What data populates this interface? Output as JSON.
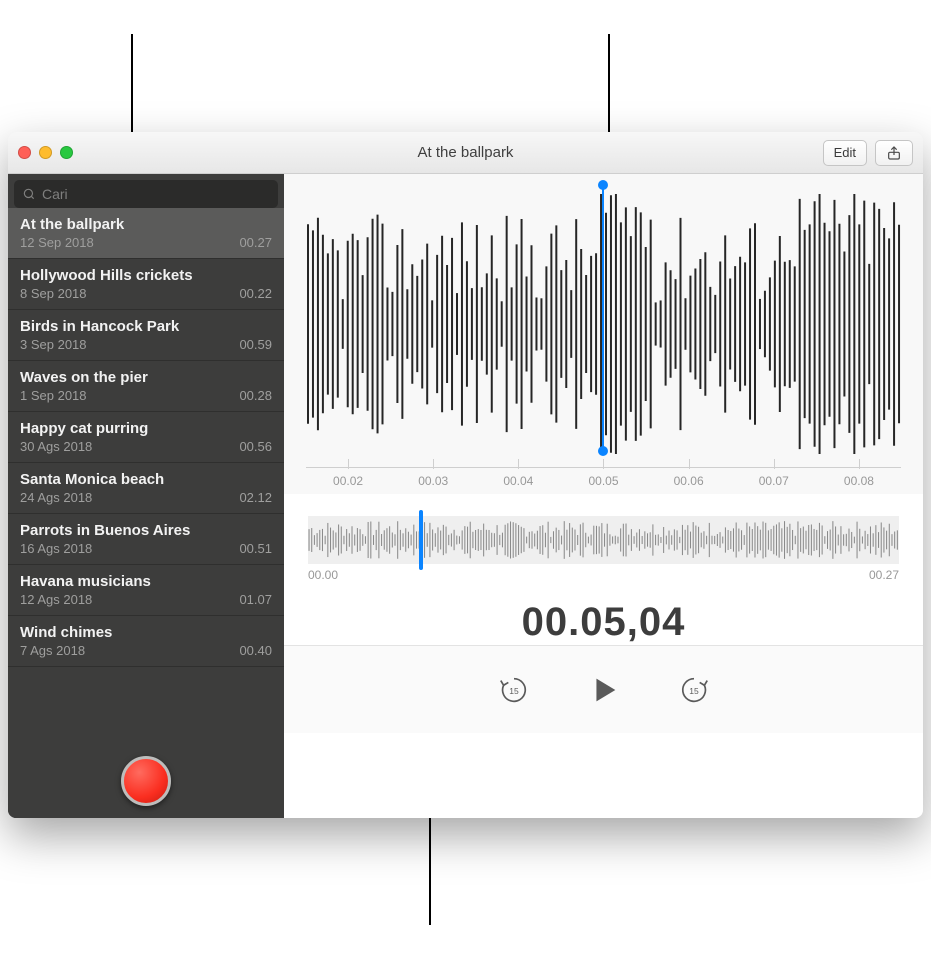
{
  "window": {
    "title": "At the ballpark"
  },
  "toolbar": {
    "edit_label": "Edit",
    "share_icon": "share-icon"
  },
  "sidebar": {
    "search_placeholder": "Cari",
    "recordings": [
      {
        "name": "At the ballpark",
        "date": "12 Sep 2018",
        "duration": "00.27",
        "selected": true
      },
      {
        "name": "Hollywood Hills crickets",
        "date": "8 Sep 2018",
        "duration": "00.22",
        "selected": false
      },
      {
        "name": "Birds in Hancock Park",
        "date": "3 Sep 2018",
        "duration": "00.59",
        "selected": false
      },
      {
        "name": "Waves on the pier",
        "date": "1 Sep 2018",
        "duration": "00.28",
        "selected": false
      },
      {
        "name": "Happy cat purring",
        "date": "30 Ags 2018",
        "duration": "00.56",
        "selected": false
      },
      {
        "name": "Santa Monica beach",
        "date": "24 Ags 2018",
        "duration": "02.12",
        "selected": false
      },
      {
        "name": "Parrots in Buenos Aires",
        "date": "16 Ags 2018",
        "duration": "00.51",
        "selected": false
      },
      {
        "name": "Havana musicians",
        "date": "12 Ags 2018",
        "duration": "01.07",
        "selected": false
      },
      {
        "name": "Wind chimes",
        "date": "7 Ags 2018",
        "duration": "00.40",
        "selected": false
      }
    ]
  },
  "main": {
    "zoom_ruler": [
      "00.02",
      "00.03",
      "00.04",
      "00.05",
      "00.06",
      "00.07",
      "00.08"
    ],
    "playhead_zoom_fraction": 0.5,
    "overview": {
      "start": "00.00",
      "end": "00.27",
      "playhead_fraction": 0.187
    },
    "time_display": "00.05,04"
  },
  "controls": {
    "skip_amount": "15"
  },
  "colors": {
    "accent": "#0a84ff",
    "record": "#fa2e20",
    "sidebar_bg": "#3d3d3c"
  }
}
